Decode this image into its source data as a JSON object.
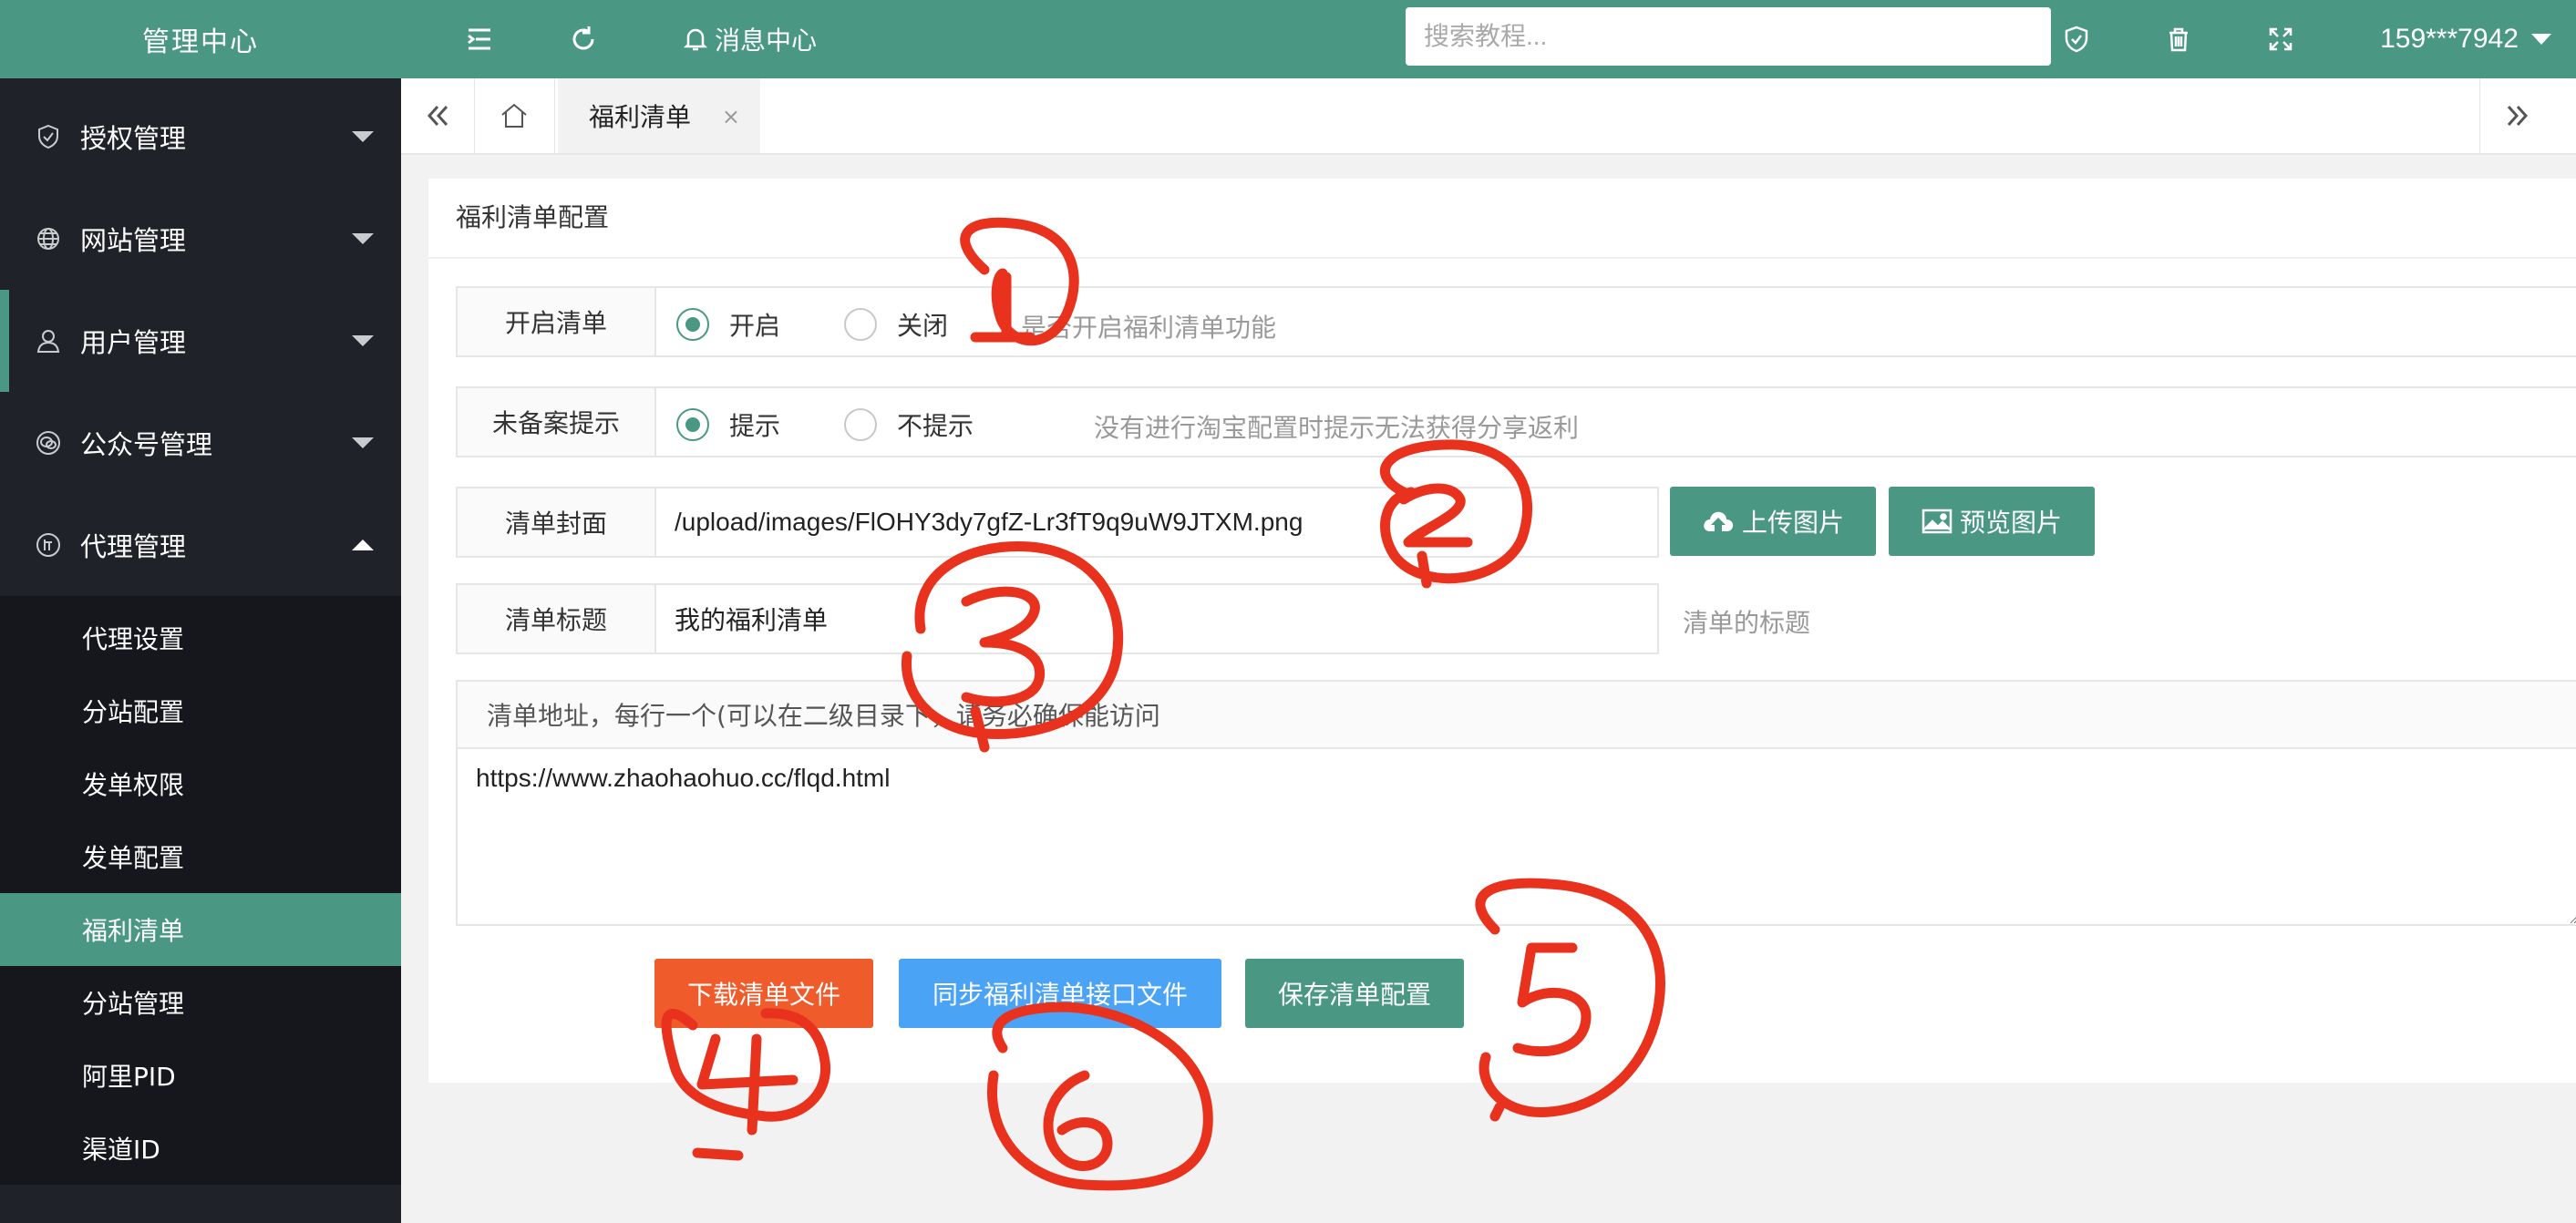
{
  "sidebar": {
    "title": "管理中心",
    "menu": [
      {
        "label": "授权管理",
        "icon": "shield-check-icon"
      },
      {
        "label": "网站管理",
        "icon": "globe-icon"
      },
      {
        "label": "用户管理",
        "icon": "user-icon"
      },
      {
        "label": "公众号管理",
        "icon": "wechat-icon"
      },
      {
        "label": "代理管理",
        "icon": "agent-icon"
      }
    ],
    "submenu": [
      "代理设置",
      "分站配置",
      "发单权限",
      "发单配置",
      "福利清单",
      "分站管理",
      "阿里PID",
      "渠道ID"
    ],
    "active_submenu": "福利清单"
  },
  "header": {
    "message_center": "消息中心",
    "search_placeholder": "搜索教程...",
    "user": "159***7942"
  },
  "tabs": {
    "active": "福利清单",
    "close": "×"
  },
  "panel": {
    "title": "福利清单配置",
    "enable": {
      "label": "开启清单",
      "options": [
        "开启",
        "关闭"
      ],
      "selected": "开启",
      "hint": "是否开启福利清单功能"
    },
    "record_tip": {
      "label": "未备案提示",
      "options": [
        "提示",
        "不提示"
      ],
      "selected": "提示",
      "hint": "没有进行淘宝配置时提示无法获得分享返利"
    },
    "cover": {
      "label": "清单封面",
      "value": "/upload/images/FlOHY3dy7gfZ-Lr3fT9q9uW9JTXM.png",
      "upload_button": "上传图片",
      "preview_button": "预览图片"
    },
    "list_title": {
      "label": "清单标题",
      "value": "我的福利清单",
      "hint": "清单的标题"
    },
    "urls": {
      "label": "清单地址，每行一个(可以在二级目录下，请务必确保能访问",
      "value": "https://www.zhaohaohuo.cc/flqd.html"
    },
    "buttons": {
      "download": "下载清单文件",
      "sync": "同步福利清单接口文件",
      "save": "保存清单配置"
    }
  },
  "colors": {
    "brand": "#4a9884",
    "sidebar_bg": "#20222a",
    "download_btn": "#ef5b2b",
    "sync_btn": "#4ba3f5",
    "annotation": "#e8321e"
  }
}
